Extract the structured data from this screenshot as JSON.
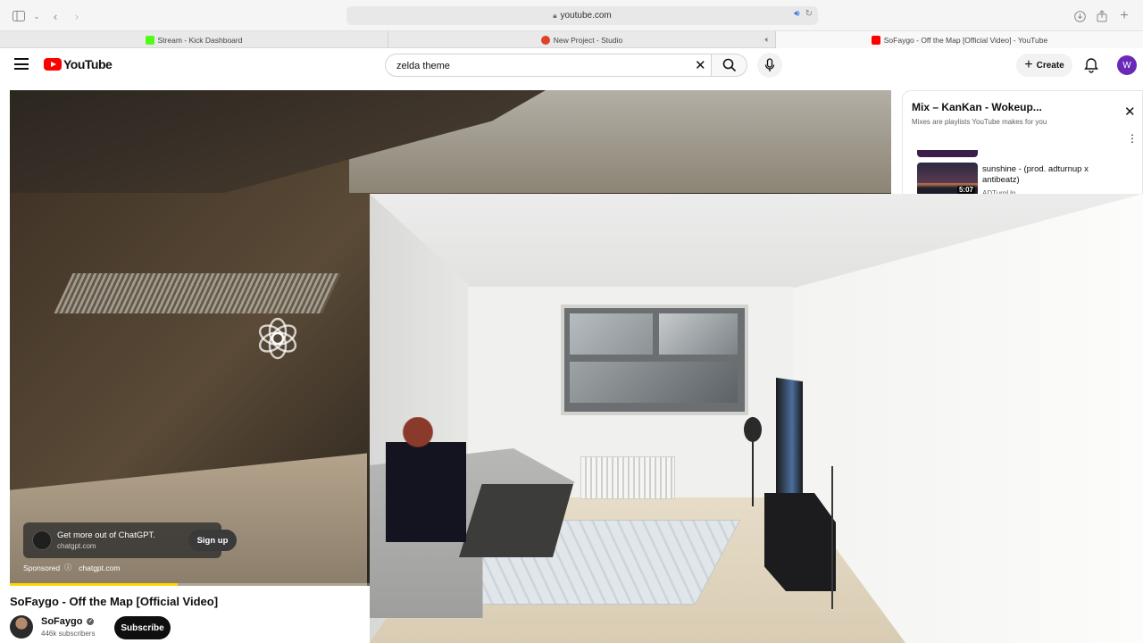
{
  "browser": {
    "url": "youtube.com",
    "tabs": [
      {
        "label": "Stream - Kick Dashboard",
        "favicon_color": "#53fc18"
      },
      {
        "label": "New Project - Studio",
        "favicon_color": "#e0412b"
      },
      {
        "label": "SoFaygo - Off the Map [Official Video] - YouTube",
        "favicon_color": "#ff0000"
      }
    ]
  },
  "header": {
    "logo_text": "YouTube",
    "search_value": "zelda theme",
    "create_label": "Create",
    "avatar_letter": "W"
  },
  "player": {
    "ad_title": "Get more out of ChatGPT.",
    "ad_domain": "chatgpt.com",
    "ad_cta": "Sign up",
    "sponsored_label": "Sponsored",
    "sponsored_domain": "chatgpt.com",
    "progress": 0.19
  },
  "video": {
    "title": "SoFaygo - Off the Map [Official Video]",
    "channel": "SoFaygo",
    "subscribers": "446k subscribers",
    "subscribe_label": "Subscribe"
  },
  "mix": {
    "title": "Mix – KanKan - Wokeup...",
    "subtitle": "Mixes are playlists YouTube makes for you",
    "items": [
      {
        "title": "sunshine - (prod. adturnup x antibeatz)",
        "channel": "ADTurnUp",
        "duration": "5:07"
      }
    ]
  },
  "colors": {
    "brand_red": "#ff0000",
    "progress_yellow": "#ffd600",
    "avatar_purple": "#6a2ab7"
  }
}
